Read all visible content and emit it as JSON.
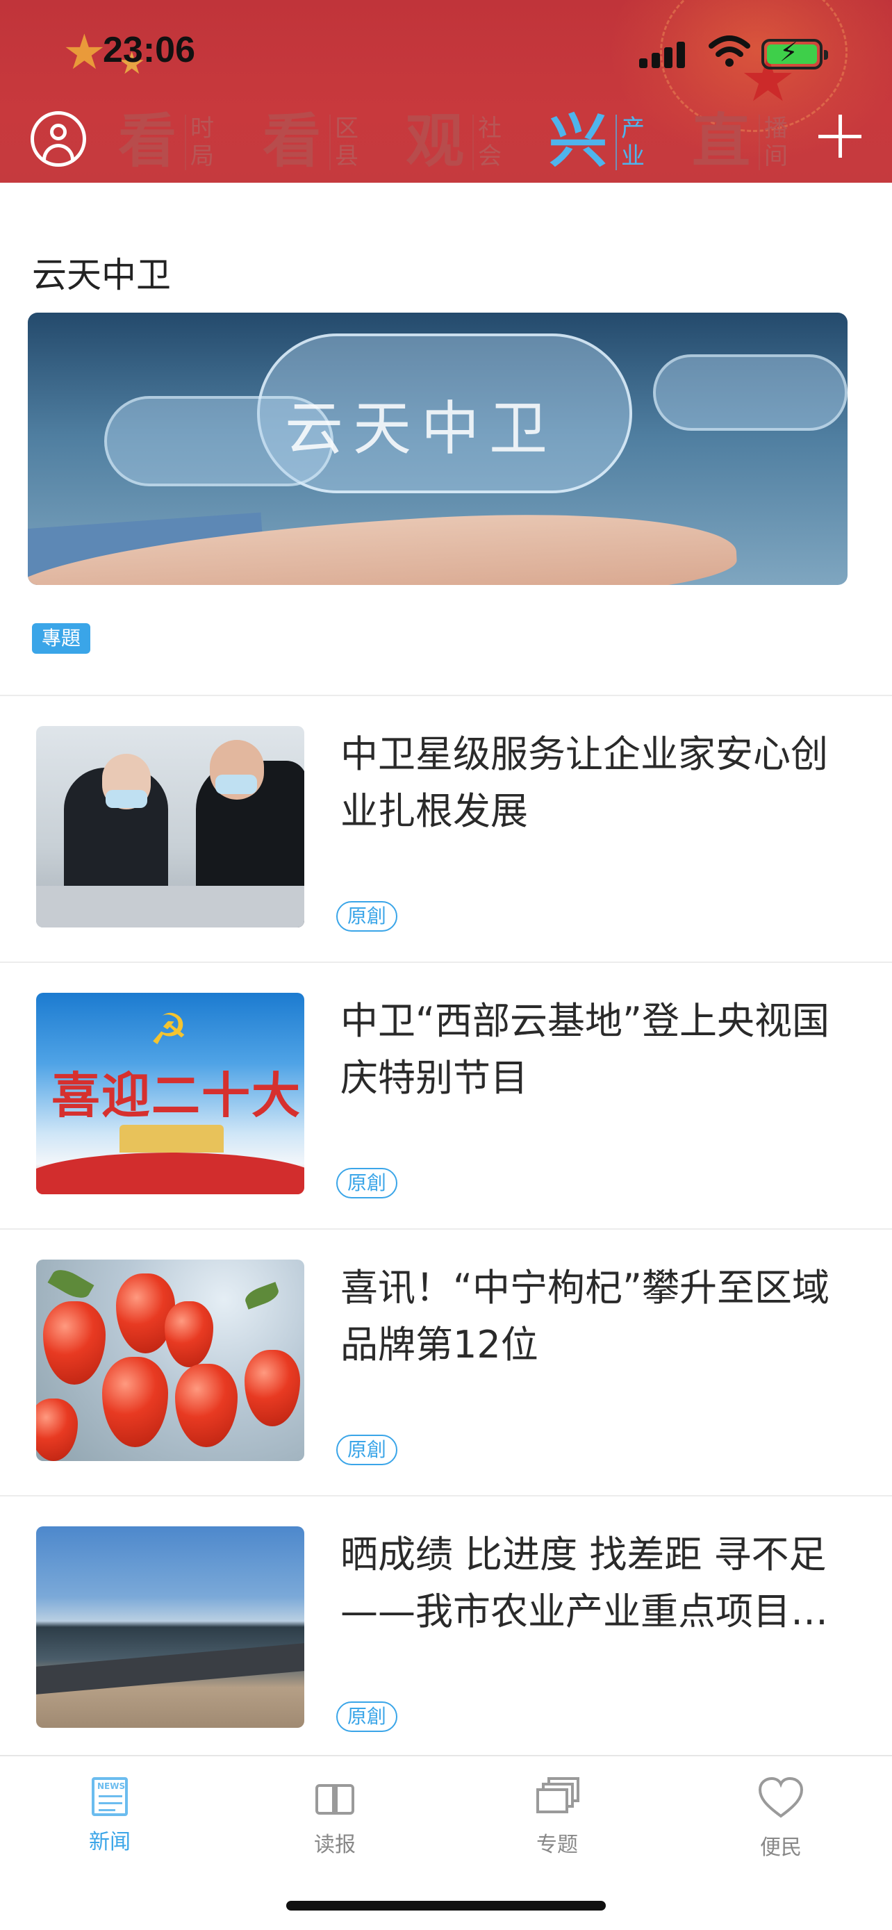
{
  "status_bar": {
    "time": "23:06"
  },
  "header": {
    "tabs": [
      {
        "big": "看",
        "sub": "时局",
        "active": false
      },
      {
        "big": "看",
        "sub": "区县",
        "active": false
      },
      {
        "big": "观",
        "sub": "社会",
        "active": false
      },
      {
        "big": "兴",
        "sub": "产业",
        "active": true
      },
      {
        "big": "直",
        "sub": "播间",
        "active": false
      }
    ]
  },
  "feature": {
    "title": "云天中卫",
    "banner_text": "云天中卫",
    "tag": "專題"
  },
  "news": [
    {
      "title": "中卫星级服务让企业家安心创业扎根发展",
      "tag": "原創"
    },
    {
      "title": "中卫“西部云基地”登上央视国庆特别节目",
      "tag": "原創",
      "thumb_text": "喜迎二十大"
    },
    {
      "title": "喜讯！“中宁枸杞”攀升至区域品牌第12位",
      "tag": "原創"
    },
    {
      "title": "晒成绩 比进度 找差距 寻不足——我市农业产业重点项目…",
      "tag": "原創"
    }
  ],
  "tabbar": {
    "items": [
      {
        "label": "新闻",
        "icon": "news-icon",
        "active": true
      },
      {
        "label": "读报",
        "icon": "newspaper-read-icon",
        "active": false
      },
      {
        "label": "专题",
        "icon": "topics-stack-icon",
        "active": false
      },
      {
        "label": "便民",
        "icon": "heart-icon",
        "active": false
      }
    ]
  },
  "colors": {
    "header_red": "#c53a3e",
    "accent_blue": "#3aa5e8",
    "active_tab_blue": "#4fb4ec"
  }
}
